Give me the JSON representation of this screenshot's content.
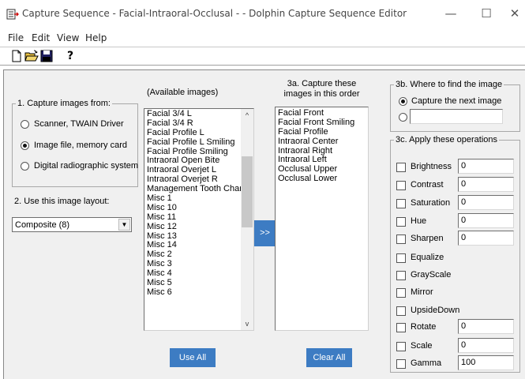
{
  "window": {
    "title": "Capture Sequence - Facial-Intraoral-Occlusal - - Dolphin Capture Sequence Editor",
    "minimize_glyph": "—",
    "maximize_glyph": "☐",
    "close_glyph": "✕"
  },
  "menu": {
    "items": [
      "File",
      "Edit",
      "View",
      "Help"
    ]
  },
  "toolbar": {
    "buttons": [
      "new-file-icon",
      "open-folder-icon",
      "save-disk-icon",
      "help-icon"
    ],
    "help_glyph": "?"
  },
  "section1": {
    "label": "1. Capture images from:",
    "options": [
      {
        "label": "Scanner, TWAIN Driver",
        "checked": false
      },
      {
        "label": "Image file, memory card",
        "checked": true
      },
      {
        "label": "Digital radiographic system",
        "checked": false
      }
    ]
  },
  "section2": {
    "label": "2. Use this image layout:",
    "value": "Composite (8)"
  },
  "available": {
    "header": "(Available images)",
    "items": [
      "Facial 3/4 L",
      "Facial 3/4 R",
      "Facial Profile L",
      "Facial Profile L Smiling",
      "Facial Profile Smiling",
      "Intraoral Open Bite",
      "Intraoral Overjet L",
      "Intraoral Overjet R",
      "Management Tooth Chart",
      "Misc 1",
      "Misc 10",
      "Misc 11",
      "Misc 12",
      "Misc 13",
      "Misc 14",
      "Misc 2",
      "Misc 3",
      "Misc 4",
      "Misc 5",
      "Misc 6"
    ],
    "use_all_label": "Use All"
  },
  "transfer": {
    "label": ">>"
  },
  "capture_order": {
    "header_line1": "3a. Capture these",
    "header_line2": "images in this order",
    "items": [
      "Facial Front",
      "Facial Front Smiling",
      "Facial Profile",
      "Intraoral Center",
      "Intraoral Right",
      "Intraoral Left",
      "Occlusal Upper",
      "Occlusal Lower"
    ],
    "clear_all_label": "Clear All"
  },
  "section3b": {
    "label": "3b. Where to find the image",
    "options": [
      {
        "label": "Capture the next image",
        "checked": true
      },
      {
        "label": "",
        "checked": false
      }
    ],
    "path_value": ""
  },
  "section3c": {
    "label": "3c. Apply these operations",
    "operations": [
      {
        "label": "Brightness",
        "value": "0"
      },
      {
        "label": "Contrast",
        "value": "0"
      },
      {
        "label": "Saturation",
        "value": "0"
      },
      {
        "label": "Hue",
        "value": "0"
      },
      {
        "label": "Sharpen",
        "value": "0"
      },
      {
        "label": "Equalize",
        "value": null
      },
      {
        "label": "GrayScale",
        "value": null
      },
      {
        "label": "Mirror",
        "value": null
      },
      {
        "label": "UpsideDown",
        "value": null
      },
      {
        "label": "Rotate",
        "value": "0"
      },
      {
        "label": "Scale",
        "value": "0"
      },
      {
        "label": "Gamma",
        "value": "100"
      }
    ]
  },
  "colors": {
    "accent_button": "#3d7cc3",
    "panel_bg": "#f0f0f0"
  }
}
